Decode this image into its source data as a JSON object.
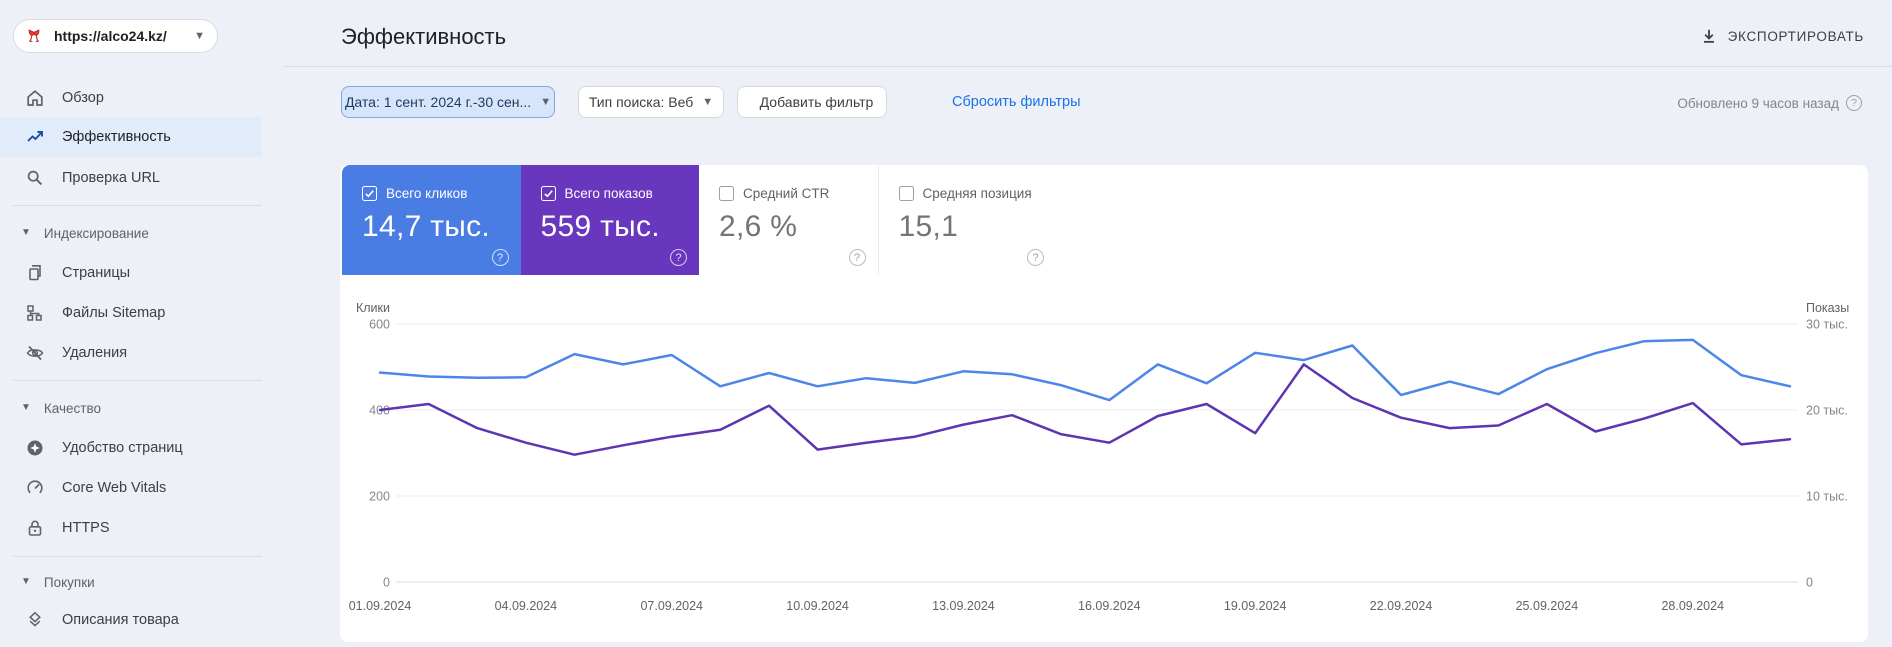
{
  "page": {
    "background": "#edf0f7",
    "panel_background": "#ffffff"
  },
  "property_selector": {
    "url": "https://alco24.kz/",
    "favicon": "wine-glasses-icon"
  },
  "sidebar": {
    "primary": [
      {
        "label": "Обзор",
        "icon": "home-icon",
        "selected": false
      },
      {
        "label": "Эффективность",
        "icon": "performance-icon",
        "selected": true
      },
      {
        "label": "Проверка URL",
        "icon": "url-inspection-icon",
        "selected": false
      }
    ],
    "sections": [
      {
        "title": "Индексирование",
        "items": [
          {
            "label": "Страницы",
            "icon": "pages-icon"
          },
          {
            "label": "Файлы Sitemap",
            "icon": "sitemap-icon"
          },
          {
            "label": "Удаления",
            "icon": "removals-icon"
          }
        ]
      },
      {
        "title": "Качество",
        "items": [
          {
            "label": "Удобство страниц",
            "icon": "page-experience-icon"
          },
          {
            "label": "Core Web Vitals",
            "icon": "core-web-vitals-icon"
          },
          {
            "label": "HTTPS",
            "icon": "https-icon"
          }
        ]
      },
      {
        "title": "Покупки",
        "items": [
          {
            "label": "Описания товара",
            "icon": "product-snippets-icon"
          }
        ]
      }
    ]
  },
  "header": {
    "title": "Эффективность",
    "export_label": "ЭКСПОРТИРОВАТЬ",
    "updated": "Обновлено 9 часов назад"
  },
  "filters": {
    "date_chip": "Дата: 1 сент. 2024 г.-30 сен...",
    "search_type_chip": "Тип поиска: Веб",
    "add_filter_label": "Добавить фильтр",
    "reset_label": "Сбросить фильтры"
  },
  "metrics": {
    "cards": [
      {
        "label": "Всего кликов",
        "value": "14,7 тыс.",
        "checked": true,
        "color": "#4a7de4"
      },
      {
        "label": "Всего показов",
        "value": "559 тыс.",
        "checked": true,
        "color": "#6937bd"
      },
      {
        "label": "Средний CTR",
        "value": "2,6 %",
        "checked": false,
        "color": "#ffffff"
      },
      {
        "label": "Средняя позиция",
        "value": "15,1",
        "checked": false,
        "color": "#ffffff"
      }
    ]
  },
  "chart_data": {
    "type": "line",
    "x": [
      "01.09.2024",
      "02.09.2024",
      "03.09.2024",
      "04.09.2024",
      "05.09.2024",
      "06.09.2024",
      "07.09.2024",
      "08.09.2024",
      "09.09.2024",
      "10.09.2024",
      "11.09.2024",
      "12.09.2024",
      "13.09.2024",
      "14.09.2024",
      "15.09.2024",
      "16.09.2024",
      "17.09.2024",
      "18.09.2024",
      "19.09.2024",
      "20.09.2024",
      "21.09.2024",
      "22.09.2024",
      "23.09.2024",
      "24.09.2024",
      "25.09.2024",
      "26.09.2024",
      "27.09.2024",
      "28.09.2024",
      "29.09.2024",
      "30.09.2024"
    ],
    "x_tick_every": 3,
    "x_tick_labels": [
      "01.09.2024",
      "04.09.2024",
      "07.09.2024",
      "10.09.2024",
      "13.09.2024",
      "16.09.2024",
      "19.09.2024",
      "22.09.2024",
      "25.09.2024",
      "28.09.2024"
    ],
    "y_left": {
      "label": "Клики",
      "ticks": [
        0,
        200,
        400,
        600
      ],
      "tick_labels": [
        "0",
        "200",
        "400",
        "600"
      ],
      "max": 600
    },
    "y_right": {
      "label": "Показы",
      "ticks": [
        0,
        10000,
        20000,
        30000
      ],
      "tick_labels": [
        "0",
        "10 тыс.",
        "20 тыс.",
        "30 тыс."
      ],
      "max": 30000
    },
    "grid": true,
    "legend": "none (metric cards act as legend)",
    "series": [
      {
        "name": "Всего кликов",
        "axis": "left",
        "color": "#4c86e8",
        "values": [
          487,
          478,
          475,
          476,
          530,
          506,
          528,
          455,
          486,
          455,
          474,
          463,
          490,
          483,
          458,
          423,
          506,
          462,
          533,
          516,
          550,
          435,
          466,
          437,
          495,
          532,
          560,
          563,
          481,
          455
        ]
      },
      {
        "name": "Всего показов",
        "axis": "right",
        "color": "#5e35b1",
        "values": [
          20000,
          20700,
          17900,
          16200,
          14800,
          15900,
          16900,
          17700,
          20500,
          15400,
          16200,
          16900,
          18300,
          19400,
          17200,
          16200,
          19300,
          20700,
          17300,
          25300,
          21400,
          19100,
          17900,
          18200,
          20700,
          17500,
          19000,
          20800,
          16000,
          16600
        ]
      }
    ]
  }
}
